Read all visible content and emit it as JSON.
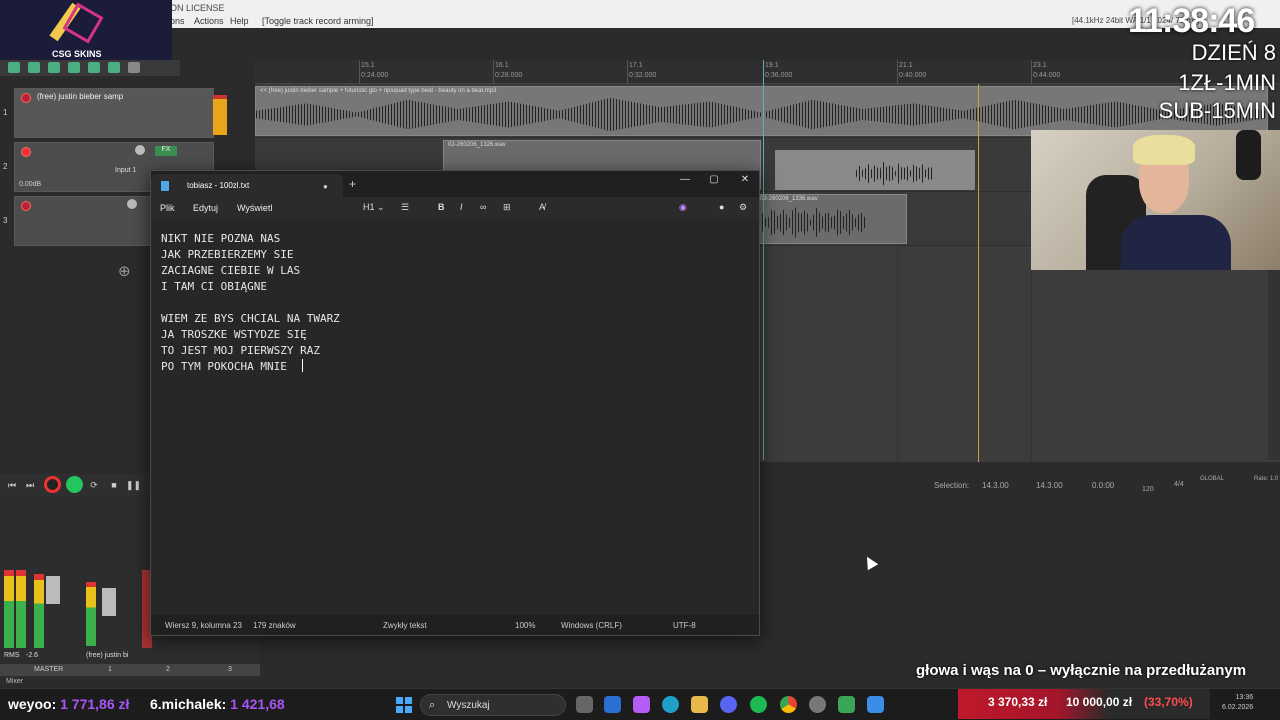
{
  "daw": {
    "license": "ON LICENSE",
    "menu": [
      "ons",
      "Actions",
      "Help",
      "[Toggle track record arming]"
    ],
    "info": "[44.1kHz 24bit WA 1/1 1024/ 78/ms]",
    "ruler": [
      {
        "bar": "15.1",
        "time": "0:24.000"
      },
      {
        "bar": "16.1",
        "time": "0:28.000"
      },
      {
        "bar": "17.1",
        "time": "0:32.000"
      },
      {
        "bar": "19.1",
        "time": "0:36.000"
      },
      {
        "bar": "21.1",
        "time": "0:40.000"
      },
      {
        "bar": "23.1",
        "time": "0:44.000"
      }
    ],
    "tracks": [
      {
        "num": "1",
        "name": "(free) justin bieber samp"
      },
      {
        "num": "2",
        "name": "",
        "input": "Input 1",
        "vol": "0.00dB"
      },
      {
        "num": "3",
        "name": ""
      }
    ],
    "items": {
      "track1": "<< (free) justin bieber sample + futuristic glo + ripsquad type beat - beauty on a beat.mp3",
      "track2a": "02-260206_1326.wav",
      "track3a": "03-260206_1336.wav"
    },
    "selection": {
      "label": "Selection:",
      "start": "14.3.00",
      "end": "14.3.00",
      "len": "0.0:00",
      "bpm": "120",
      "sig": "4/4",
      "global": "GLOBAL",
      "rate": "Rate: 1.0"
    },
    "mixer": {
      "master": "MASTER",
      "track_label": "(free) justin bi",
      "rms": "RMS",
      "rms_val": "-2.6",
      "mixer_tab": "Mixer",
      "tabs": [
        "1",
        "2",
        "3"
      ]
    }
  },
  "notepad": {
    "tab_title": "tobiasz - 100zl.txt",
    "menu": [
      "Plik",
      "Edytuj",
      "Wyświetl"
    ],
    "heading_btn": "H1",
    "text": "NIKT NIE POZNA NAS\nJAK PRZEBIERZEMY SIE\nZACIAGNE CIEBIE W LAS\nI TAM CI OBIĄGNE\n\nWIEM ZE BYS CHCIAL NA TWARZ\nJA TROSZKE WSTYDZE SIĘ\nTO JEST MOJ PIERWSZY RAZ\nPO TYM POKOCHA MNIE  ",
    "status": {
      "position": "Wiersz 9, kolumna 23",
      "chars": "179 znaków",
      "format": "Zwykły tekst",
      "zoom": "100%",
      "eol": "Windows (CRLF)",
      "encoding": "UTF-8"
    }
  },
  "overlay": {
    "logo": "CSG SKINS",
    "clock": "11:38:46",
    "lines": [
      "DZIEŃ 8",
      "1ZŁ-1MIN",
      "SUB-15MIN"
    ],
    "promo": "głowa i wąs na 0 – wyłącznie na przedłużanym",
    "donors": [
      {
        "name": "weyoo:",
        "amount": "1 771,86 zł"
      },
      {
        "name": "6.michalek:",
        "amount": "1 421,68"
      }
    ],
    "goal": {
      "current": "3 370,33 zł",
      "target": "10 000,00 zł",
      "percent": "(33,70%)"
    }
  },
  "taskbar": {
    "search": "Wyszukaj",
    "time": "13:36",
    "date": "6.02.2026"
  },
  "colors": {
    "accent_green": "#22c55e",
    "record_red": "#e33333",
    "purple": "#a855f7",
    "goal_red": "#c0182b"
  }
}
